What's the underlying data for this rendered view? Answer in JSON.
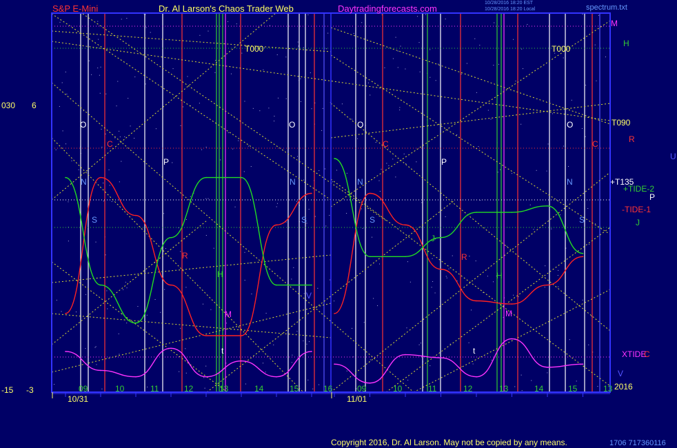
{
  "header": {
    "symbol": "S&P E-Mini",
    "site_title": "Dr. Al Larson's Chaos Trader Web",
    "url": "Daytradingforecasts.com",
    "stamp1": "10/28/2016 18:20 EST",
    "stamp2": "10/28/2016 18:20 Local",
    "file": "spectrum.txt"
  },
  "footer": {
    "copyright": "Copyright 2016, Dr. Al Larson. May not be copied by any means.",
    "code": "1706 717360116",
    "year": "2016"
  },
  "axis_left": {
    "top_outer": "030",
    "top_inner": "6",
    "bottom_outer": "-15",
    "bottom_inner": "-3"
  },
  "dates": [
    "10/31",
    "11/01"
  ],
  "hour_ticks_day1": [
    "09",
    "10",
    "11",
    "12",
    "13",
    "14",
    "15",
    "16"
  ],
  "hour_ticks_day2": [
    "09",
    "10",
    "11",
    "12",
    "13",
    "14",
    "15",
    "13"
  ],
  "right_labels": {
    "M": "M",
    "H": "H",
    "T090": "T090",
    "R": "R",
    "U": "U",
    "T135": "+T135",
    "tide2": "+TIDE-2",
    "P": "P",
    "tide1": "-TIDE-1",
    "J": "J",
    "xtide": "XTIDE",
    "C": "C",
    "V": "V"
  },
  "chart_labels": {
    "T000a": "T000",
    "T000b": "T000",
    "O1": "O",
    "O2": "O",
    "O3": "O",
    "O4": "O",
    "C1": "C",
    "C2": "C",
    "C3": "C",
    "P1": "P",
    "P2": "P",
    "N1": "N",
    "N2": "N",
    "N3": "N",
    "N4": "N",
    "S1": "S",
    "S2": "S",
    "S3": "S",
    "S4": "S",
    "R1": "R",
    "R2": "R",
    "H1": "H",
    "H2": "H",
    "M1": "M",
    "M2": "M",
    "t1": "t",
    "t2": "t",
    "J1": "J",
    "V1": "V"
  },
  "colors": {
    "background": "#000066",
    "plot_border": "#3333ff",
    "tide1": "#ff2222",
    "tide2": "#22dd22",
    "xtide": "#ff33ff",
    "rays": "#dddd33",
    "white_lines": "#ffffff",
    "red_lines": "#ff3333",
    "green_lines": "#33cc33",
    "magenta_lines": "#ff33ff",
    "blue_lines": "#5555ff"
  },
  "chart_data": {
    "type": "line",
    "title": "S&P E-Mini",
    "x": [
      "10/31 09",
      "10/31 10",
      "10/31 11",
      "10/31 12",
      "10/31 13",
      "10/31 14",
      "10/31 15",
      "10/31 16",
      "11/01 09",
      "11/01 10",
      "11/01 11",
      "11/01 12",
      "11/01 13",
      "11/01 14",
      "11/01 15",
      "11/01 16"
    ],
    "y_left_scale": [
      -15,
      30
    ],
    "y_inner_scale": [
      -3,
      6
    ],
    "series": [
      {
        "name": "TIDE-1",
        "color": "#ff2222",
        "values": [
          -0.6,
          3.7,
          2.5,
          0.3,
          -1.3,
          -1.3,
          2.2,
          3.2,
          -0.6,
          3.2,
          2.2,
          0.8,
          -0.2,
          -0.3,
          0.3,
          1.2
        ]
      },
      {
        "name": "TIDE-2",
        "color": "#22dd22",
        "values": [
          3.7,
          0.3,
          -0.9,
          1.8,
          3.7,
          3.7,
          0.3,
          0.3,
          4.3,
          1.2,
          1.2,
          1.8,
          2.6,
          2.6,
          2.8,
          1.3
        ]
      },
      {
        "name": "XTIDE",
        "color": "#ff33ff",
        "values": [
          -1.8,
          -2.4,
          -2.6,
          -1.7,
          -2.6,
          -2.1,
          -2.6,
          -1.8,
          -2.2,
          -2.8,
          -1.9,
          -2.0,
          -2.6,
          -1.4,
          -2.3,
          -2.2
        ]
      }
    ],
    "grid": true
  }
}
